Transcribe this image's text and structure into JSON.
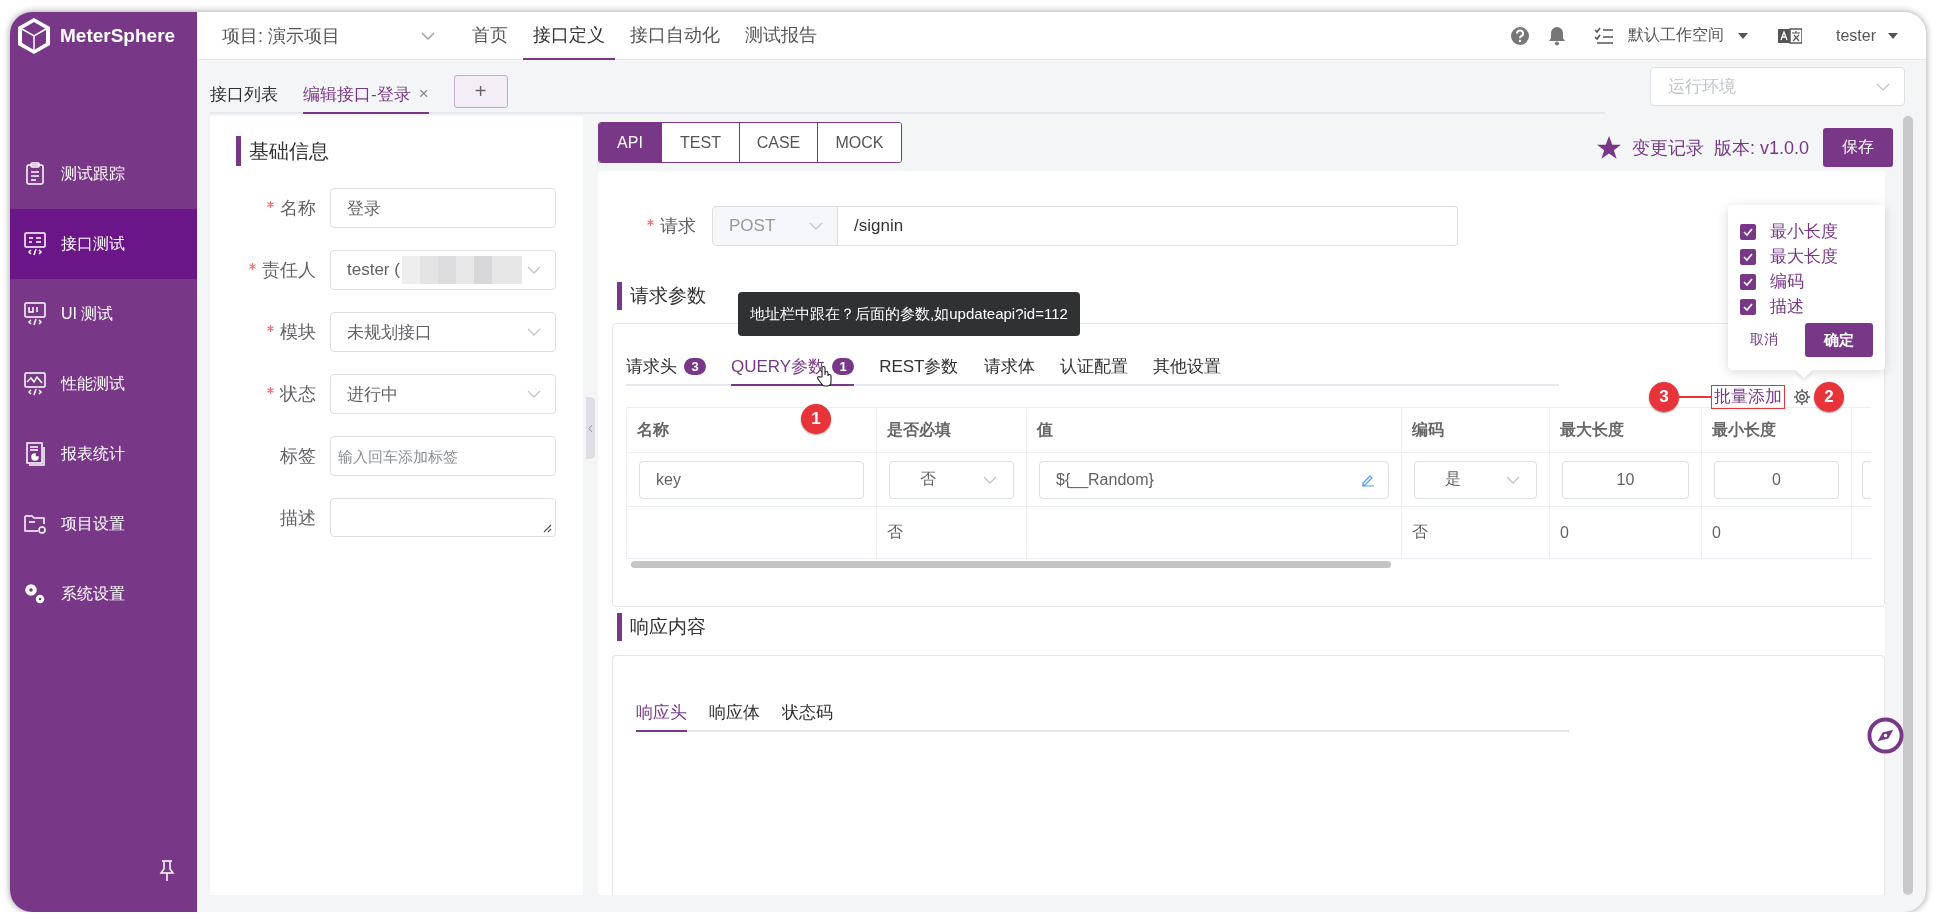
{
  "app": {
    "name": "MeterSphere"
  },
  "sidebar": {
    "items": [
      {
        "label": "测试跟踪",
        "kind": "clipboard",
        "selected": false
      },
      {
        "label": "接口测试",
        "kind": "api",
        "selected": true
      },
      {
        "label": "UI 测试",
        "kind": "ui",
        "selected": false
      },
      {
        "label": "性能测试",
        "kind": "performance",
        "selected": false
      },
      {
        "label": "报表统计",
        "kind": "report",
        "selected": false
      },
      {
        "label": "项目设置",
        "kind": "folder",
        "selected": false
      },
      {
        "label": "系统设置",
        "kind": "gears",
        "selected": false
      }
    ]
  },
  "header": {
    "project": "项目: 演示项目",
    "nav": [
      {
        "label": "首页",
        "selected": false
      },
      {
        "label": "接口定义",
        "selected": true
      },
      {
        "label": "接口自动化",
        "selected": false
      },
      {
        "label": "测试报告",
        "selected": false
      }
    ],
    "workspace": "默认工作空间",
    "user": "tester"
  },
  "page_tabs": {
    "tabs": [
      {
        "label": "接口列表",
        "selected": false
      },
      {
        "label": "编辑接口-登录",
        "selected": true,
        "close": "×"
      }
    ],
    "add": "+"
  },
  "environment": {
    "placeholder": "运行环境"
  },
  "basic_info": {
    "title": "基础信息",
    "fields": [
      {
        "label": "名称",
        "required": true,
        "kind": "input",
        "value": "登录"
      },
      {
        "label": "责任人",
        "required": true,
        "kind": "select",
        "value": "tester (",
        "redacted": true
      },
      {
        "label": "模块",
        "required": true,
        "kind": "select",
        "value": "未规划接口"
      },
      {
        "label": "状态",
        "required": true,
        "kind": "select",
        "value": "进行中"
      },
      {
        "label": "标签",
        "required": false,
        "kind": "input",
        "placeholder": "输入回车添加标签"
      },
      {
        "label": "描述",
        "required": false,
        "kind": "textarea"
      }
    ]
  },
  "mode_tabs": [
    {
      "label": "API",
      "selected": true
    },
    {
      "label": "TEST",
      "selected": false
    },
    {
      "label": "CASE",
      "selected": false
    },
    {
      "label": "MOCK",
      "selected": false
    }
  ],
  "toolbar": {
    "history": "变更记录",
    "version": "版本: v1.0.0",
    "save": "保存"
  },
  "request": {
    "label": "请求",
    "required": true,
    "method": "POST",
    "url": "/signin"
  },
  "params": {
    "title": "请求参数",
    "tooltip": "地址栏中跟在？后面的参数,如updateapi?id=112",
    "tabs": [
      {
        "label": "请求头",
        "badge": "3",
        "selected": false
      },
      {
        "label": "QUERY参数",
        "badge": "1",
        "selected": true
      },
      {
        "label": "REST参数",
        "selected": false
      },
      {
        "label": "请求体",
        "selected": false
      },
      {
        "label": "认证配置",
        "selected": false
      },
      {
        "label": "其他设置",
        "selected": false
      }
    ],
    "batch_add": "批量添加",
    "markers": [
      {
        "label": "1"
      },
      {
        "label": "2"
      },
      {
        "label": "3"
      }
    ],
    "columns": [
      "名称",
      "是否必填",
      "值",
      "编码",
      "最大长度",
      "最小长度"
    ],
    "rows": [
      {
        "kind": "input",
        "name": "key",
        "required": "否",
        "value": "${__Random}",
        "encode": "是",
        "max_length": "10",
        "min_length": "0"
      },
      {
        "kind": "text",
        "required": "否",
        "encode": "否",
        "max_length": "0",
        "min_length": "0"
      }
    ]
  },
  "column_settings": {
    "options": [
      {
        "label": "最小长度",
        "checked": true
      },
      {
        "label": "最大长度",
        "checked": true
      },
      {
        "label": "编码",
        "checked": true
      },
      {
        "label": "描述",
        "checked": true
      }
    ],
    "cancel": "取消",
    "confirm": "确定"
  },
  "response": {
    "title": "响应内容",
    "tabs": [
      {
        "label": "响应头",
        "selected": true
      },
      {
        "label": "响应体",
        "selected": false
      },
      {
        "label": "状态码",
        "selected": false
      }
    ]
  }
}
